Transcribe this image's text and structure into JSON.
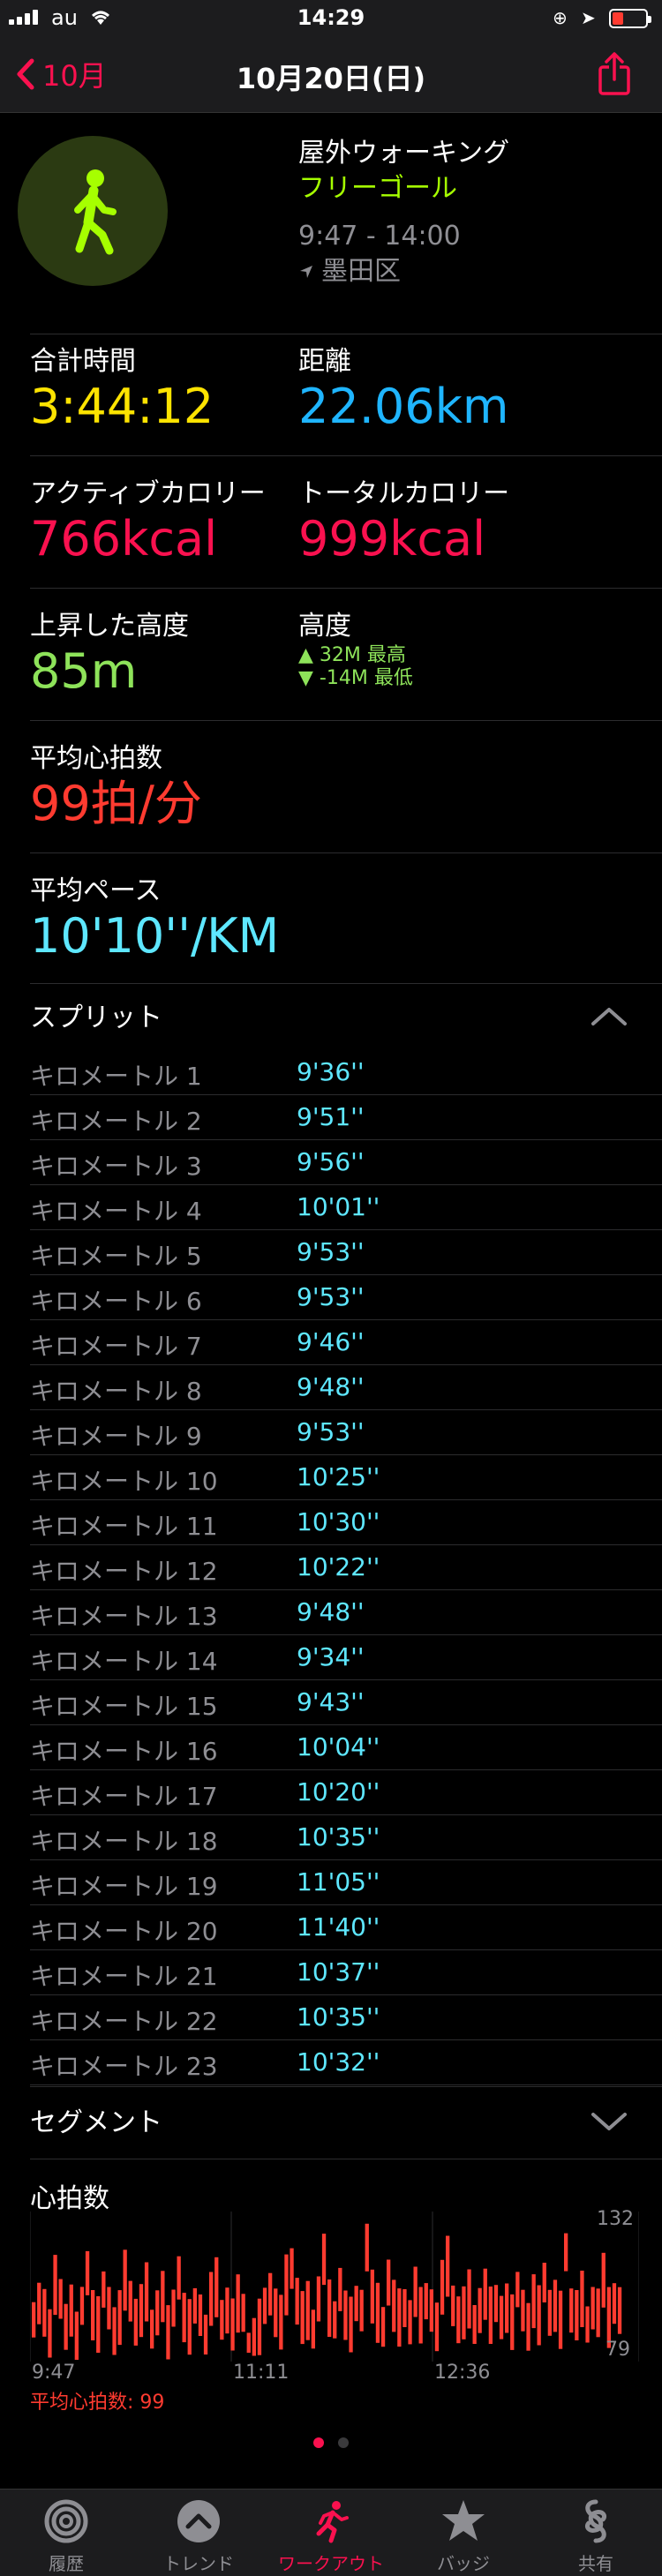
{
  "status": {
    "carrier": "au",
    "time": "14:29"
  },
  "nav": {
    "back_label": "10月",
    "title": "10月20日(日)"
  },
  "workout": {
    "title": "屋外ウォーキング",
    "goal": "フリーゴール",
    "time_range": "9:47 - 14:00",
    "location": "墨田区"
  },
  "metrics": {
    "total_time_label": "合計時間",
    "total_time": "3:44:12",
    "distance_label": "距離",
    "distance": "22.06km",
    "active_cal_label": "アクティブカロリー",
    "active_cal": "766kcal",
    "total_cal_label": "トータルカロリー",
    "total_cal": "999kcal",
    "elevation_gain_label": "上昇した高度",
    "elevation_gain": "85m",
    "elevation_label": "高度",
    "elevation_high": "▲ 32M 最高",
    "elevation_low": "▼ -14M 最低",
    "avg_hr_label": "平均心拍数",
    "avg_hr": "99拍/分",
    "avg_pace_label": "平均ペース",
    "avg_pace": "10'10''/KM"
  },
  "splits": {
    "title": "スプリット",
    "rows": [
      {
        "km": "キロメートル 1",
        "pace": "9'36''"
      },
      {
        "km": "キロメートル 2",
        "pace": "9'51''"
      },
      {
        "km": "キロメートル 3",
        "pace": "9'56''"
      },
      {
        "km": "キロメートル 4",
        "pace": "10'01''"
      },
      {
        "km": "キロメートル 5",
        "pace": "9'53''"
      },
      {
        "km": "キロメートル 6",
        "pace": "9'53''"
      },
      {
        "km": "キロメートル 7",
        "pace": "9'46''"
      },
      {
        "km": "キロメートル 8",
        "pace": "9'48''"
      },
      {
        "km": "キロメートル 9",
        "pace": "9'53''"
      },
      {
        "km": "キロメートル 10",
        "pace": "10'25''"
      },
      {
        "km": "キロメートル 11",
        "pace": "10'30''"
      },
      {
        "km": "キロメートル 12",
        "pace": "10'22''"
      },
      {
        "km": "キロメートル 13",
        "pace": "9'48''"
      },
      {
        "km": "キロメートル 14",
        "pace": "9'34''"
      },
      {
        "km": "キロメートル 15",
        "pace": "9'43''"
      },
      {
        "km": "キロメートル 16",
        "pace": "10'04''"
      },
      {
        "km": "キロメートル 17",
        "pace": "10'20''"
      },
      {
        "km": "キロメートル 18",
        "pace": "10'35''"
      },
      {
        "km": "キロメートル 19",
        "pace": "11'05''"
      },
      {
        "km": "キロメートル 20",
        "pace": "11'40''"
      },
      {
        "km": "キロメートル 21",
        "pace": "10'37''"
      },
      {
        "km": "キロメートル 22",
        "pace": "10'35''"
      },
      {
        "km": "キロメートル 23",
        "pace": "10'32''"
      }
    ]
  },
  "segments": {
    "title": "セグメント"
  },
  "heart_rate": {
    "title": "心拍数",
    "max_label": "132",
    "min_label": "79",
    "time_ticks": [
      "9:47",
      "11:11",
      "12:36"
    ],
    "avg_label": "平均心拍数: 99"
  },
  "chart_data": {
    "type": "bar",
    "title": "心拍数",
    "x_ticks": [
      "9:47",
      "11:11",
      "12:36"
    ],
    "ylim": [
      79,
      132
    ],
    "avg": 99,
    "color": "#ff3b30",
    "values": [
      95,
      102,
      98,
      88,
      110,
      104,
      92,
      99,
      86,
      101,
      115,
      97,
      93,
      108,
      100,
      90,
      96,
      112,
      103,
      94,
      99,
      107,
      91,
      98,
      105,
      89,
      100,
      113,
      96,
      92,
      101,
      97,
      87,
      104,
      109,
      95,
      99,
      93,
      102,
      98,
      80,
      85,
      92,
      101,
      106,
      98,
      94,
      110,
      117,
      103,
      96,
      99,
      91,
      104,
      121,
      100,
      95,
      108,
      97,
      93,
      102,
      99,
      126,
      105,
      98,
      92,
      111,
      101,
      96,
      100,
      94,
      107,
      97,
      103,
      99,
      92,
      109,
      118,
      101,
      95,
      98,
      104,
      93,
      99,
      106,
      97,
      102,
      96,
      100,
      94,
      108,
      99,
      92,
      103,
      97,
      111,
      98,
      101,
      95,
      124,
      99,
      97,
      104,
      93,
      100,
      98,
      112,
      96,
      102,
      99
    ]
  },
  "pager": {
    "active_color": "#fa114f",
    "inactive_color": "#3a3a3c"
  },
  "tabs": [
    {
      "label": "履歴",
      "icon": "history-rings-icon"
    },
    {
      "label": "トレンド",
      "icon": "trends-chevron-icon"
    },
    {
      "label": "ワークアウト",
      "icon": "workout-runner-icon"
    },
    {
      "label": "バッジ",
      "icon": "badge-star-icon"
    },
    {
      "label": "共有",
      "icon": "sharing-icon"
    }
  ]
}
